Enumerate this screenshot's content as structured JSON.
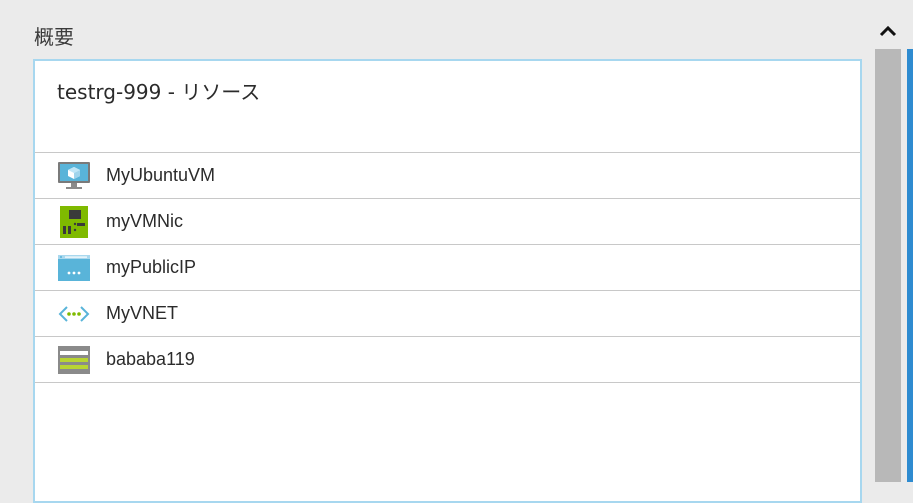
{
  "section_title": "概要",
  "tile": {
    "title": "testrg-999 - リソース",
    "resources": [
      {
        "name": "MyUbuntuVM",
        "icon": "virtual-machine-icon"
      },
      {
        "name": "myVMNic",
        "icon": "network-interface-icon"
      },
      {
        "name": "myPublicIP",
        "icon": "public-ip-icon"
      },
      {
        "name": "MyVNET",
        "icon": "virtual-network-icon"
      },
      {
        "name": "bababa119",
        "icon": "storage-account-icon"
      }
    ]
  },
  "colors": {
    "tile_border": "#a7d7ef",
    "accent": "#2e8bd0",
    "scrollbar": "#b8b8b8"
  }
}
